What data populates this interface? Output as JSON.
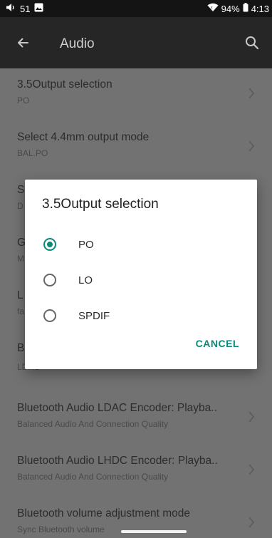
{
  "status_bar": {
    "notification_count": "51",
    "battery": "94%",
    "time": "4:13"
  },
  "app_bar": {
    "title": "Audio"
  },
  "settings": [
    {
      "title": "3.5Output selection",
      "subtitle": "PO"
    },
    {
      "title": "Select 4.4mm output mode",
      "subtitle": "BAL.PO"
    },
    {
      "title": "S",
      "subtitle": "D"
    },
    {
      "title": "G",
      "subtitle": "M"
    },
    {
      "title": "L",
      "subtitle": "fa"
    },
    {
      "title": "B",
      "subtitle": "LDAC"
    },
    {
      "title": "Bluetooth Audio LDAC Encoder: Playba..",
      "subtitle": "Balanced Audio And Connection Quality"
    },
    {
      "title": "Bluetooth Audio LHDC Encoder: Playba..",
      "subtitle": "Balanced Audio And Connection Quality"
    },
    {
      "title": "Bluetooth volume adjustment mode",
      "subtitle": "Sync Bluetooth volume"
    }
  ],
  "dialog": {
    "title": "3.5Output selection",
    "options": [
      {
        "label": "PO",
        "selected": true
      },
      {
        "label": "LO",
        "selected": false
      },
      {
        "label": "SPDIF",
        "selected": false
      }
    ],
    "cancel_label": "CANCEL"
  },
  "colors": {
    "accent": "#0b8a7a",
    "scrim_background": "#727272",
    "app_bar": "#262626",
    "status_bar": "#141414"
  },
  "icons": {
    "status_volume": "volume-icon",
    "status_image": "image-notification-icon",
    "status_wifi": "wifi-icon",
    "status_battery": "battery-icon",
    "back": "arrow-back-icon",
    "search": "search-icon",
    "row_chevron": "chevron-right-icon"
  }
}
